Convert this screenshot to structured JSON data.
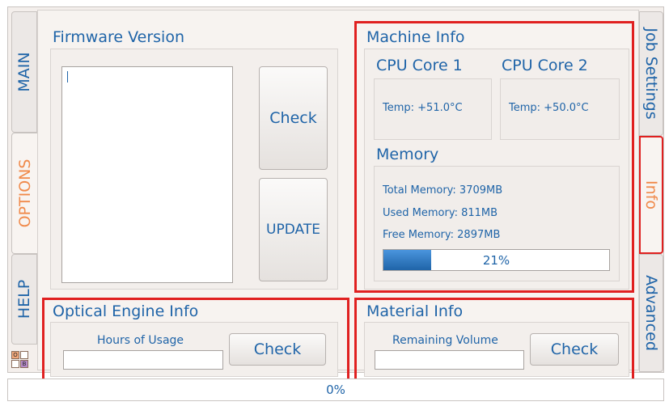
{
  "tabs_left": [
    {
      "label": "MAIN"
    },
    {
      "label": "OPTIONS"
    },
    {
      "label": "HELP"
    }
  ],
  "tabs_right": [
    {
      "label": "Job Settings"
    },
    {
      "label": "Info"
    },
    {
      "label": "Advanced"
    }
  ],
  "firmware": {
    "title": "Firmware Version",
    "text": "",
    "check_label": "Check",
    "update_label": "UPDATE"
  },
  "machine": {
    "title": "Machine Info",
    "cpu1": {
      "label": "CPU Core 1",
      "temp": "Temp: +51.0°C"
    },
    "cpu2": {
      "label": "CPU Core 2",
      "temp": "Temp: +50.0°C"
    },
    "memory": {
      "title": "Memory",
      "total": "Total Memory: 3709MB",
      "used": "Used Memory: 811MB",
      "free": "Free Memory: 2897MB",
      "usage_percent": 21,
      "usage_label": "21%"
    }
  },
  "optical": {
    "title": "Optical Engine Info",
    "hours_label": "Hours of Usage",
    "hours_value": "",
    "check_label": "Check"
  },
  "material": {
    "title": "Material Info",
    "volume_label": "Remaining Volume",
    "volume_value": "",
    "check_label": "Check"
  },
  "legend_badge": {
    "top_left": "O",
    "bottom_right": "B"
  },
  "status": {
    "progress_label": "0%",
    "progress_percent": 0
  },
  "colors": {
    "accent": "#1f64a8",
    "active_tab": "#f08a4b",
    "highlight": "#e02020",
    "progress_fill": "#2a78c8"
  }
}
